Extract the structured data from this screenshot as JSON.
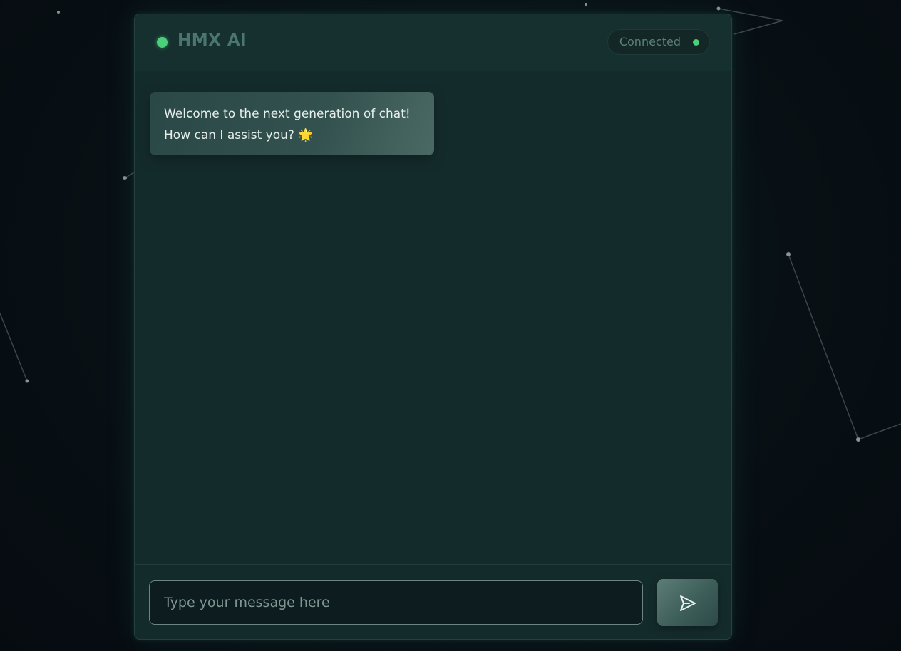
{
  "header": {
    "title": "HMX AI",
    "status_label": "Connected"
  },
  "messages": [
    {
      "sender": "assistant",
      "text": "Welcome to the next generation of chat! How can I assist you?",
      "emoji": "🌟"
    }
  ],
  "composer": {
    "placeholder": "Type your message here",
    "value": ""
  },
  "icons": {
    "status": "status-dot-icon",
    "connection": "connection-dot-icon",
    "send": "send-icon"
  },
  "colors": {
    "accent_green": "#4ccf7a",
    "panel": "#142b2c",
    "background": "#080e14",
    "bubble": "#33524f"
  }
}
